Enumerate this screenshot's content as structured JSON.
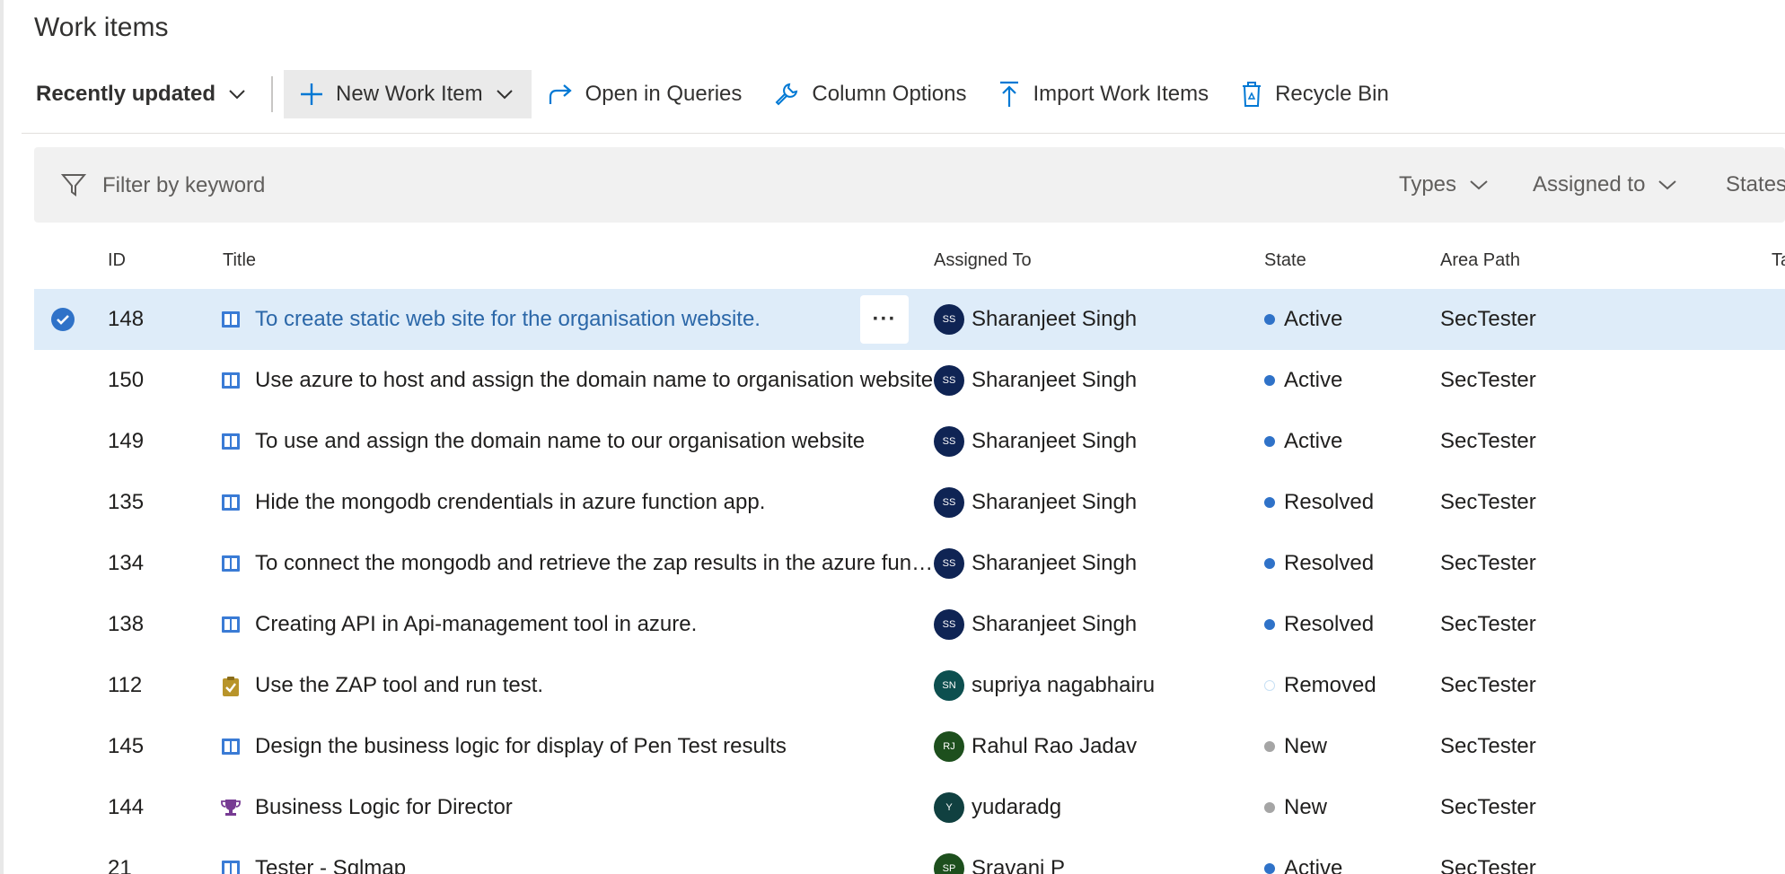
{
  "page": {
    "title": "Work items"
  },
  "toolbar": {
    "view_label": "Recently updated",
    "new_item_label": "New Work Item",
    "open_queries_label": "Open in Queries",
    "column_options_label": "Column Options",
    "import_label": "Import Work Items",
    "recycle_label": "Recycle Bin"
  },
  "filter": {
    "placeholder": "Filter by keyword",
    "types_label": "Types",
    "assigned_label": "Assigned to",
    "states_label": "States"
  },
  "columns": {
    "id": "ID",
    "title": "Title",
    "assigned": "Assigned To",
    "state": "State",
    "area": "Area Path",
    "tags": "Tags"
  },
  "colors": {
    "accent": "#0078d4",
    "selected_row": "#deecf9",
    "link": "#2b67a8",
    "state_active": "#2f72c8",
    "state_new": "#a5a5a5"
  },
  "rows": [
    {
      "id": "148",
      "title": "To create static web site for the organisation website.",
      "type_icon": "user-story-icon",
      "assignee": "Sharanjeet Singh",
      "initials": "SS",
      "avatar_color": "#0f2454",
      "state": "Active",
      "state_color": "#2f72c8",
      "area": "SecTester",
      "selected": true
    },
    {
      "id": "150",
      "title": "Use azure to host and assign the domain name to organisation website",
      "type_icon": "user-story-icon",
      "assignee": "Sharanjeet Singh",
      "initials": "SS",
      "avatar_color": "#0f2454",
      "state": "Active",
      "state_color": "#2f72c8",
      "area": "SecTester"
    },
    {
      "id": "149",
      "title": "To use and assign the domain name to our organisation website",
      "type_icon": "user-story-icon",
      "assignee": "Sharanjeet Singh",
      "initials": "SS",
      "avatar_color": "#0f2454",
      "state": "Active",
      "state_color": "#2f72c8",
      "area": "SecTester"
    },
    {
      "id": "135",
      "title": "Hide the mongodb crendentials in azure function app.",
      "type_icon": "user-story-icon",
      "assignee": "Sharanjeet Singh",
      "initials": "SS",
      "avatar_color": "#0f2454",
      "state": "Resolved",
      "state_color": "#2f72c8",
      "area": "SecTester"
    },
    {
      "id": "134",
      "title": "To connect the mongodb and retrieve the zap results in the azure function",
      "type_icon": "user-story-icon",
      "assignee": "Sharanjeet Singh",
      "initials": "SS",
      "avatar_color": "#0f2454",
      "state": "Resolved",
      "state_color": "#2f72c8",
      "area": "SecTester"
    },
    {
      "id": "138",
      "title": "Creating API in Api-management tool in azure.",
      "type_icon": "user-story-icon",
      "assignee": "Sharanjeet Singh",
      "initials": "SS",
      "avatar_color": "#0f2454",
      "state": "Resolved",
      "state_color": "#2f72c8",
      "area": "SecTester"
    },
    {
      "id": "112",
      "title": "Use the ZAP tool and run test.",
      "type_icon": "task-icon",
      "assignee": "supriya nagabhairu",
      "initials": "SN",
      "avatar_color": "#0d4f4f",
      "state": "Removed",
      "state_color": "#c7e0f4",
      "area": "SecTester"
    },
    {
      "id": "145",
      "title": "Design the business logic for display of Pen Test results",
      "type_icon": "user-story-icon",
      "assignee": "Rahul Rao Jadav",
      "initials": "RJ",
      "avatar_color": "#1d4f1d",
      "state": "New",
      "state_color": "#a5a5a5",
      "area": "SecTester"
    },
    {
      "id": "144",
      "title": "Business Logic for Director",
      "type_icon": "epic-icon",
      "assignee": "yudaradg",
      "initials": "Y",
      "avatar_color": "#104040",
      "state": "New",
      "state_color": "#a5a5a5",
      "area": "SecTester"
    },
    {
      "id": "21",
      "title": "Tester - Sqlmap",
      "type_icon": "user-story-icon",
      "assignee": "Sravani P",
      "initials": "SP",
      "avatar_color": "#1d4f1d",
      "state": "Active",
      "state_color": "#2f72c8",
      "area": "SecTester"
    }
  ]
}
